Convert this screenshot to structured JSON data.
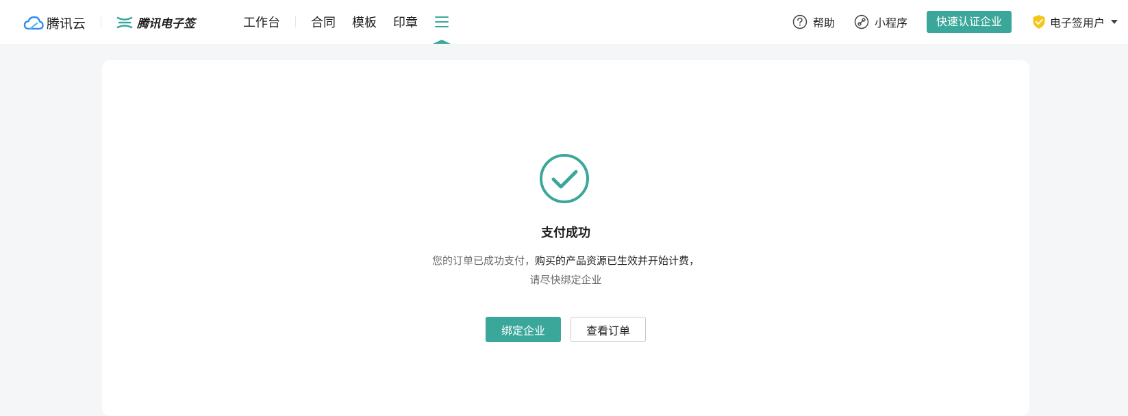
{
  "header": {
    "cloud_brand": "腾讯云",
    "esign_brand": "腾讯电子签",
    "nav": {
      "workbench": "工作台",
      "contract": "合同",
      "template": "模板",
      "seal": "印章"
    },
    "help_label": "帮助",
    "miniapp_label": "小程序",
    "certify_button": "快速认证企业",
    "user_label": "电子签用户"
  },
  "result": {
    "title": "支付成功",
    "message_part1": "您的订单已成功支付，",
    "message_part2": "购买的产品资源已生效并开始计费，",
    "message_line2": "请尽快绑定企业",
    "bind_button": "绑定企业",
    "view_order_button": "查看订单"
  },
  "colors": {
    "accent": "#3aa79a",
    "cloud_blue": "#2e8ef0",
    "shield_yellow": "#f5c518"
  },
  "icons": {
    "cloud": "tencent-cloud-logo-icon",
    "esign": "esign-logo-icon",
    "menu": "hamburger-menu-icon",
    "help": "question-circle-icon",
    "miniapp": "link-circle-icon",
    "shield": "shield-check-icon",
    "caret": "caret-down-icon",
    "success": "check-circle-icon"
  }
}
